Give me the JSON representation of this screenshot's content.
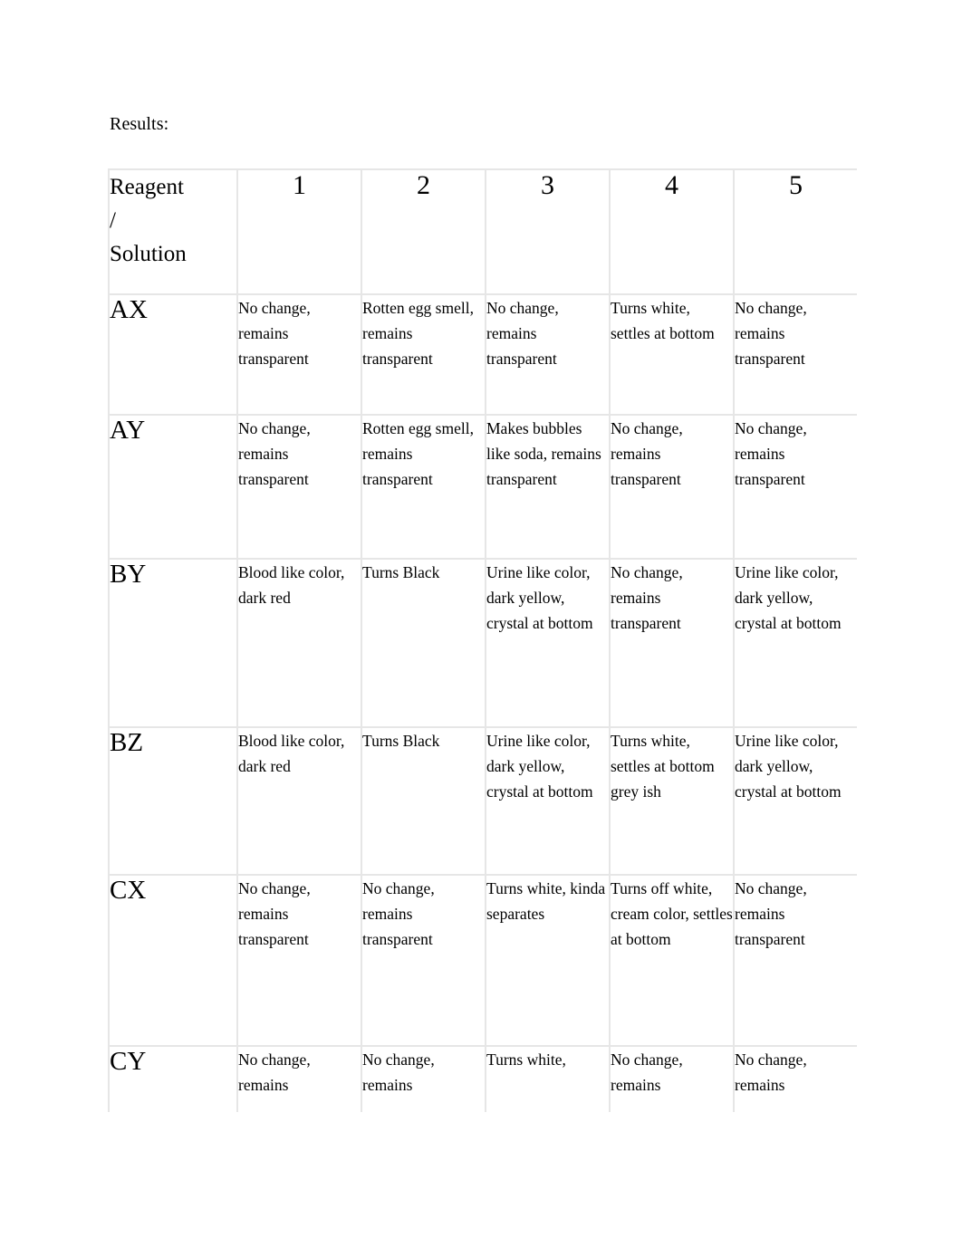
{
  "document": {
    "heading": "Results:"
  },
  "table": {
    "headers": {
      "row_label": "Reagent / Solution",
      "row_label_line1": "Reagent",
      "row_label_line2": "/",
      "row_label_line3": "Solution",
      "columns": [
        "1",
        "2",
        "3",
        "4",
        "5"
      ]
    },
    "rows": [
      {
        "label": "AX",
        "cells": [
          "No change, remains transparent",
          "Rotten egg smell, remains transparent",
          "No change, remains transparent",
          "Turns white, settles at bottom",
          "No change, remains transparent"
        ]
      },
      {
        "label": "AY",
        "cells": [
          "No change, remains transparent",
          "Rotten egg smell, remains transparent",
          "Makes bubbles like soda, remains transparent",
          "No change, remains transparent",
          "No change, remains transparent"
        ]
      },
      {
        "label": "BY",
        "cells": [
          "Blood like color, dark red",
          "Turns Black",
          "Urine like color, dark yellow, crystal at bottom",
          "No change, remains transparent",
          "Urine like color, dark yellow, crystal at bottom"
        ]
      },
      {
        "label": "BZ",
        "cells": [
          "Blood like color, dark red",
          "Turns Black",
          "Urine like color, dark yellow, crystal at bottom",
          "Turns white, settles at bottom grey ish",
          "Urine like color, dark yellow, crystal at bottom"
        ]
      },
      {
        "label": "CX",
        "cells": [
          "No change, remains transparent",
          "No change, remains transparent",
          "Turns white, kinda separates",
          "Turns off white, cream color, settles at bottom",
          "No change, remains transparent"
        ]
      },
      {
        "label": "CY",
        "cells": [
          "No change, remains",
          "No change, remains",
          "Turns white,",
          "No change, remains",
          "No change, remains"
        ]
      }
    ]
  },
  "style": {
    "page_background": "#ffffff",
    "text_color": "#000000",
    "table_border_color": "#e6e6e6"
  }
}
